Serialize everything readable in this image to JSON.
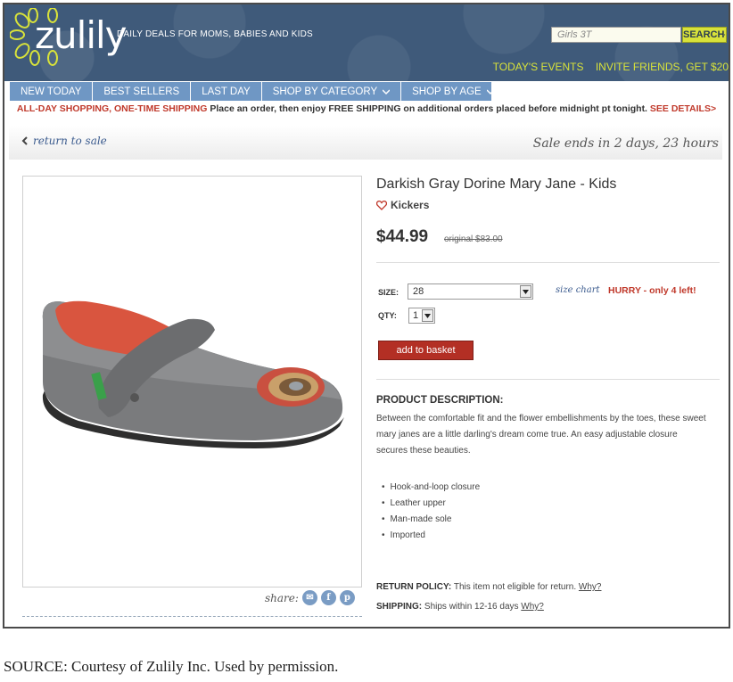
{
  "header": {
    "logo_text": "zulily",
    "tagline": "DAILY DEALS FOR MOMS, BABIES AND KIDS",
    "search_placeholder": "Girls 3T",
    "search_button": "SEARCH",
    "links": [
      "TODAY'S EVENTS",
      "INVITE FRIENDS, GET $20"
    ]
  },
  "nav": {
    "items": [
      "NEW TODAY",
      "BEST SELLERS",
      "LAST DAY",
      "SHOP BY CATEGORY",
      "SHOP BY AGE"
    ]
  },
  "promo": {
    "highlight": "ALL-DAY SHOPPING, ONE-TIME SHIPPING",
    "text": " Place an order, then enjoy FREE SHIPPING on additional orders placed before midnight pt tonight. ",
    "link": "SEE DETAILS>"
  },
  "returnbar": {
    "return_link": "return to sale",
    "sale_ends": "Sale ends in 2 days, 23 hours"
  },
  "product": {
    "title": "Darkish Gray Dorine Mary Jane - Kids",
    "brand": "Kickers",
    "price": "$44.99",
    "original": "original $83.00",
    "size_label": "SIZE:",
    "size_value": "28",
    "size_chart": "size chart",
    "hurry": "HURRY - only 4 left!",
    "qty_label": "QTY:",
    "qty_value": "1",
    "add_button": "add to basket",
    "desc_heading": "PRODUCT DESCRIPTION:",
    "description": "Between the comfortable fit and the flower embellishments by the toes, these sweet mary janes are a little darling's dream come true. An easy adjustable closure secures these beauties.",
    "features": [
      "Hook-and-loop closure",
      "Leather upper",
      "Man-made sole",
      "Imported"
    ],
    "return_label": "RETURN POLICY:",
    "return_text": " This item not eligible for return. ",
    "shipping_label": "SHIPPING:",
    "shipping_text": " Ships within 12-16 days ",
    "why": "Why?",
    "share_label": "share:"
  },
  "source": "SOURCE: Courtesy of Zulily Inc. Used by permission.",
  "colors": {
    "header_bg": "#3f5a7a",
    "nav_bg": "#6f97c4",
    "accent_lime": "#d8e23a",
    "button_red": "#b32f24",
    "alert_red": "#c0392b"
  }
}
